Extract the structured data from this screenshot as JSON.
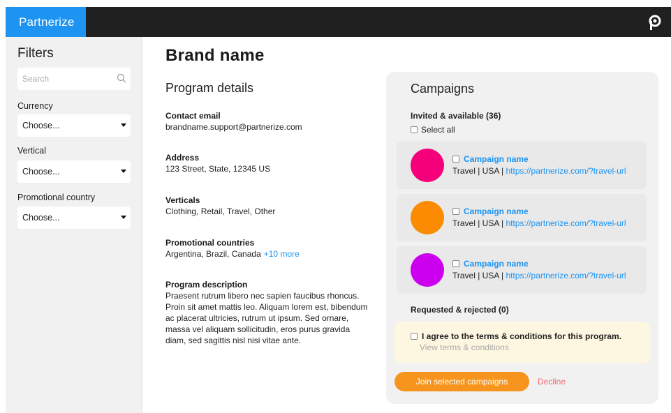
{
  "header": {
    "logo_text": "Partnerize",
    "logo_bg": "#1d94f2",
    "bar_bg": "#202020",
    "brand_icon": "partnerize-p-icon"
  },
  "sidebar": {
    "title": "Filters",
    "search_placeholder": "Search",
    "filters": [
      {
        "label": "Currency",
        "value": "Choose..."
      },
      {
        "label": "Vertical",
        "value": "Choose..."
      },
      {
        "label": "Promotional country",
        "value": "Choose..."
      }
    ]
  },
  "main": {
    "brand_name": "Brand name",
    "section_title": "Program details",
    "details": [
      {
        "label": "Contact email",
        "value": "brandname.support@partnerize.com"
      },
      {
        "label": "Address",
        "value": "123 Street, State, 12345 US"
      },
      {
        "label": "Verticals",
        "value": "Clothing, Retail, Travel, Other"
      },
      {
        "label": "Promotional countries",
        "value": "Argentina, Brazil, Canada",
        "more": "+10 more"
      },
      {
        "label": "Program description",
        "value": "Praesent rutrum libero nec sapien faucibus rhoncus. Proin sit amet mattis leo. Aliquam lorem est, bibendum ac placerat ultricies, rutrum ut ipsum. Sed ornare, massa vel aliquam sollicitudin, eros purus gravida diam, sed sagittis nisl nisi vitae ante."
      }
    ]
  },
  "campaigns": {
    "title": "Campaigns",
    "invited_heading": "Invited & available (36)",
    "select_all": "Select all",
    "items": [
      {
        "name": "Campaign name",
        "meta": "Travel | USA |",
        "url": "https://partnerize.com/?travel-url",
        "color": "#f5007a"
      },
      {
        "name": "Campaign name",
        "meta": "Travel | USA |",
        "url": "https://partnerize.com/?travel-url",
        "color": "#fb8b00"
      },
      {
        "name": "Campaign name",
        "meta": "Travel | USA |",
        "url": "https://partnerize.com/?travel-url",
        "color": "#cc00ee"
      }
    ],
    "requested_heading": "Requested & rejected (0)",
    "terms_text": "I agree to the terms & conditions for this program.",
    "terms_link": "View terms & conditions",
    "join_label": "Join selected campaigns",
    "decline_label": "Decline",
    "accent": "#f7941d"
  }
}
